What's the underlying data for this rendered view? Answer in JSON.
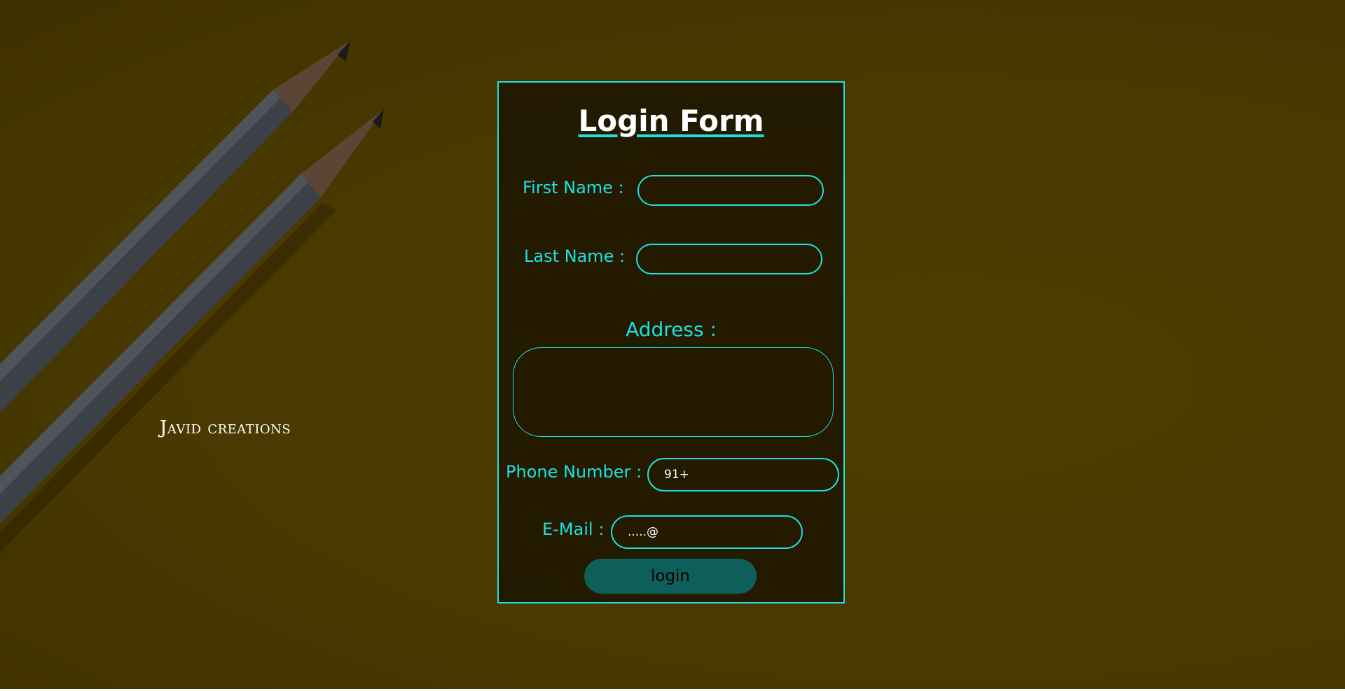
{
  "brand": {
    "text": "Javid creations"
  },
  "form": {
    "title": "Login Form",
    "first_name": {
      "label": "First Name :",
      "value": ""
    },
    "last_name": {
      "label": "Last Name :",
      "value": ""
    },
    "address": {
      "label": "Address :",
      "value": ""
    },
    "phone": {
      "label": "Phone Number :",
      "placeholder": "91+"
    },
    "email": {
      "label": "E-Mail :",
      "placeholder": ".....@"
    },
    "login_button": "login"
  },
  "colors": {
    "background": "#4a3900",
    "accent": "#1ee0df",
    "button": "#0e5f5a"
  }
}
